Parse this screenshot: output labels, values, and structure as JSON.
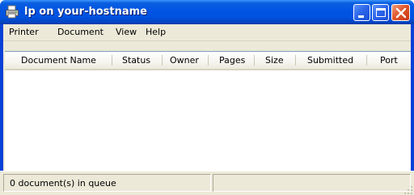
{
  "window": {
    "title": "lp on your-hostname",
    "icon": "printer-icon",
    "controls": [
      "minimize-icon",
      "maximize-icon",
      "close-icon"
    ]
  },
  "menu": [
    "Printer",
    "Document",
    "View",
    "Help"
  ],
  "list": {
    "columns": [
      "Document Name",
      "Status",
      "Owner",
      "Pages",
      "Size",
      "Submitted",
      "Port"
    ],
    "rows": []
  },
  "status": {
    "text": "0 document(s) in queue"
  }
}
